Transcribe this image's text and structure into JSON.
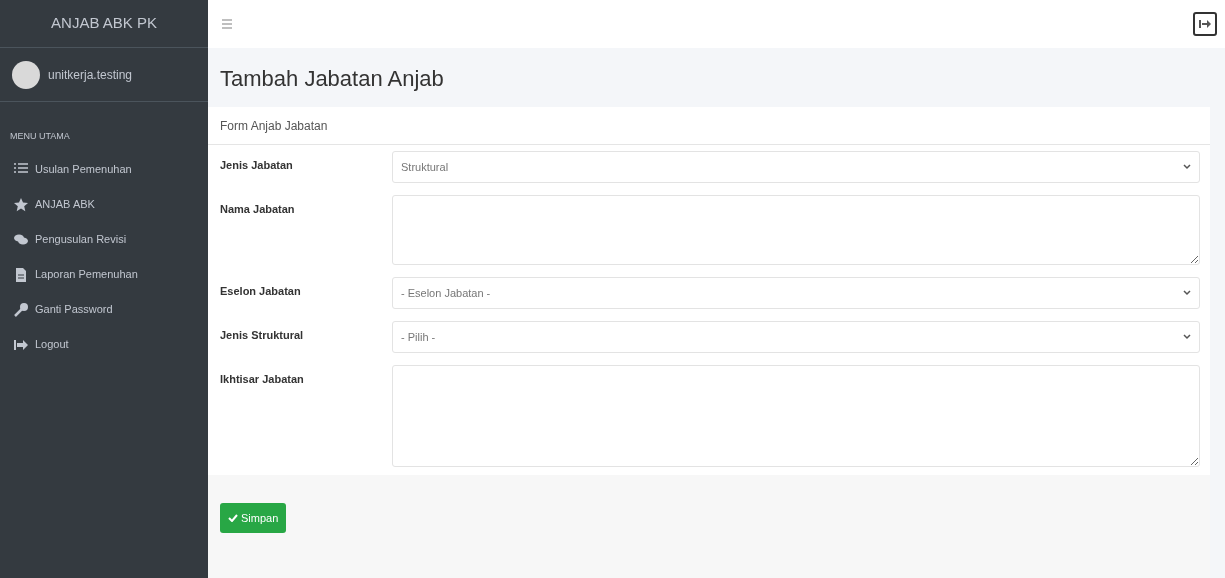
{
  "sidebar": {
    "brand": "ANJAB ABK PK",
    "user": "unitkerja.testing",
    "section": "MENU UTAMA",
    "items": [
      {
        "label": "Usulan Pemenuhan",
        "selected": false
      },
      {
        "label": "ANJAB ABK",
        "selected": false
      },
      {
        "label": "Pengusulan Revisi",
        "selected": false
      },
      {
        "label": "Laporan Pemenuhan",
        "selected": false
      },
      {
        "label": "Ganti Password",
        "selected": false
      },
      {
        "label": "Logout",
        "selected": false
      }
    ]
  },
  "page_title": "Tambah Jabatan Anjab",
  "card": {
    "title": "Form Anjab Jabatan",
    "fields": [
      {
        "label": "Jenis Jabatan",
        "kind": "select",
        "value": "Struktural"
      },
      {
        "label": "Nama Jabatan",
        "kind": "textarea"
      },
      {
        "label": "Eselon Jabatan",
        "kind": "select",
        "value": "- Eselon Jabatan -"
      },
      {
        "label": "Jenis Struktural",
        "kind": "select",
        "value": "- Pilih -"
      },
      {
        "label": "Ikhtisar Jabatan",
        "kind": "textarea"
      }
    ],
    "submit": "Simpan"
  }
}
